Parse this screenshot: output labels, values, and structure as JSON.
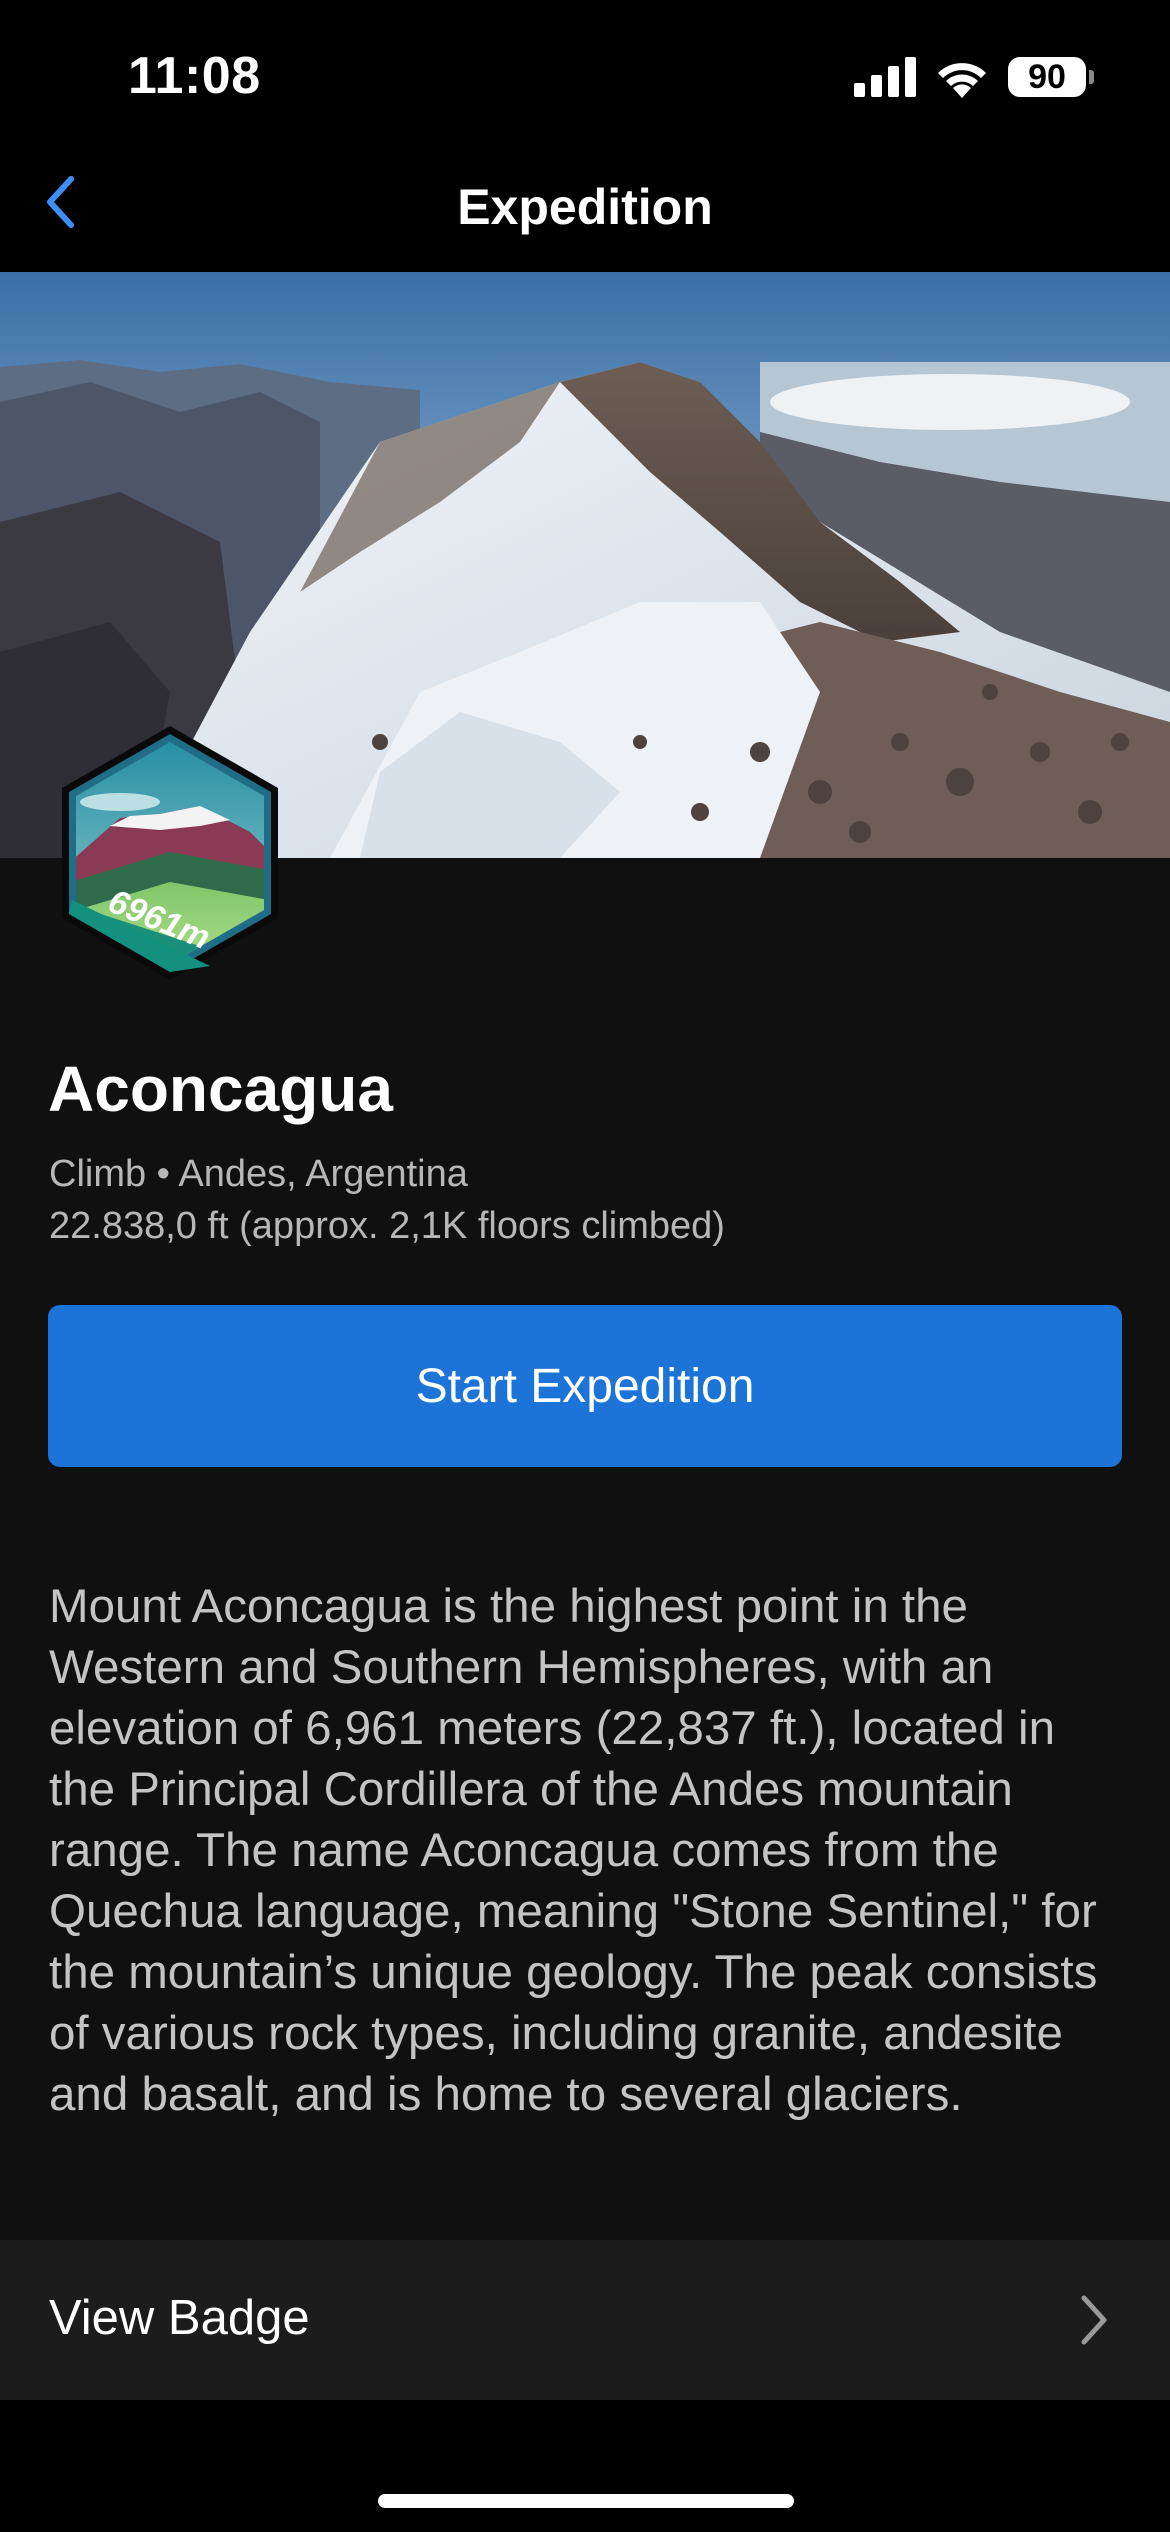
{
  "status_bar": {
    "time": "11:08",
    "battery": "90",
    "icons": [
      "cellular-signal-icon",
      "wifi-icon",
      "battery-icon"
    ]
  },
  "nav": {
    "title": "Expedition",
    "back_icon": "chevron-left-icon",
    "accent_color": "#3e8ef7"
  },
  "hero": {
    "image": "mountain-summit-photo"
  },
  "badge": {
    "text": "6961m",
    "icon": "mountain-badge-icon"
  },
  "expedition": {
    "name": "Aconcagua",
    "meta_line1": "Climb • Andes, Argentina",
    "meta_line2": "22.838,0 ft (approx. 2,1K floors climbed)",
    "start_label": "Start Expedition",
    "button_color": "#1c73d8",
    "description": "Mount Aconcagua is the highest point in the Western and Southern Hemispheres, with an elevation of 6,961 meters (22,837 ft.), located in the Principal Cordillera of the Andes mountain range. The name Aconcagua comes from the Quechua language, meaning \"Stone Sentinel,\" for the mountain’s unique geology. The peak consists of various rock types, including granite, andesite and basalt, and is home to several glaciers."
  },
  "view_badge": {
    "label": "View Badge",
    "icon": "chevron-right-icon"
  }
}
